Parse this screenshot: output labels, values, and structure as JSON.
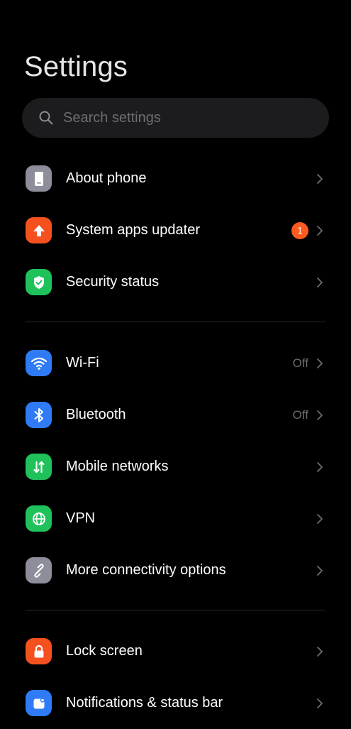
{
  "header": {
    "title": "Settings"
  },
  "search": {
    "placeholder": "Search settings"
  },
  "sections": [
    {
      "items": [
        {
          "label": "About phone",
          "icon": "phone-icon",
          "icon_bg": "#8e8e9a"
        },
        {
          "label": "System apps updater",
          "icon": "arrow-up-icon",
          "icon_bg": "#f4511e",
          "badge": "1"
        },
        {
          "label": "Security status",
          "icon": "shield-check-icon",
          "icon_bg": "#1fc25a"
        }
      ]
    },
    {
      "items": [
        {
          "label": "Wi-Fi",
          "icon": "wifi-icon",
          "icon_bg": "#2f7bf5",
          "value": "Off"
        },
        {
          "label": "Bluetooth",
          "icon": "bluetooth-icon",
          "icon_bg": "#2f7bf5",
          "value": "Off"
        },
        {
          "label": "Mobile networks",
          "icon": "mobile-data-icon",
          "icon_bg": "#1fc25a"
        },
        {
          "label": "VPN",
          "icon": "globe-icon",
          "icon_bg": "#1fc25a"
        },
        {
          "label": "More connectivity options",
          "icon": "link-icon",
          "icon_bg": "#8e8e9a"
        }
      ]
    },
    {
      "items": [
        {
          "label": "Lock screen",
          "icon": "lock-icon",
          "icon_bg": "#f4511e"
        },
        {
          "label": "Notifications & status bar",
          "icon": "notification-icon",
          "icon_bg": "#2f7bf5"
        }
      ]
    }
  ],
  "colors": {
    "background": "#000000",
    "search_bg": "#1c1c1e",
    "secondary_text": "#6d6d72",
    "badge": "#ff5a1f"
  }
}
